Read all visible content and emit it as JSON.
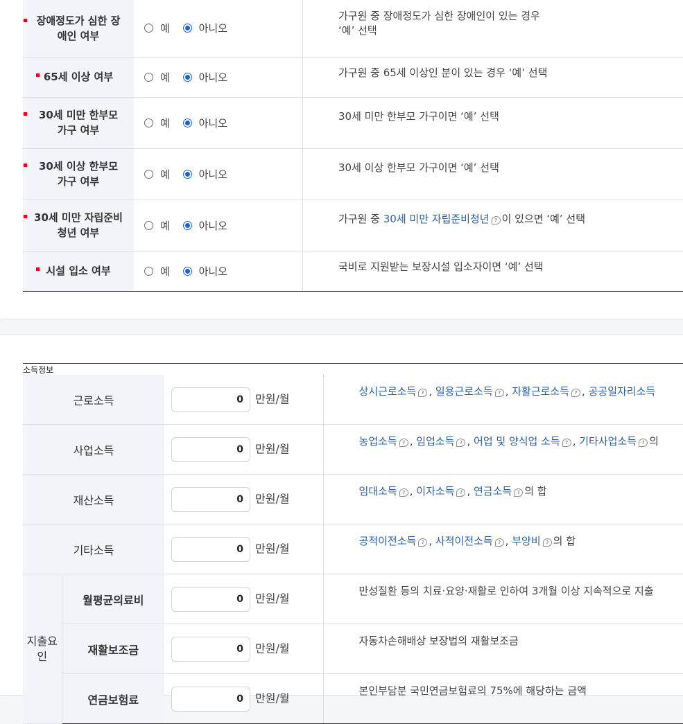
{
  "household": {
    "rows": [
      {
        "label_lines": [
          "장애정도가 심한 장",
          "애인 여부"
        ],
        "yes": "예",
        "no": "아니오",
        "selected": "no",
        "desc_lines": [
          "가구원 중 장애정도가 심한 장애인이 있는 경우",
          "‘예’ 선택"
        ]
      },
      {
        "label_lines": [
          "65세 이상 여부"
        ],
        "yes": "예",
        "no": "아니오",
        "selected": "no",
        "desc_lines": [
          "가구원 중 65세 이상인 분이 있는 경우 ‘예’ 선택"
        ]
      },
      {
        "label_lines": [
          "30세 미만 한부모",
          "가구 여부"
        ],
        "yes": "예",
        "no": "아니오",
        "selected": "no",
        "desc_lines": [
          "30세 미만 한부모 가구이면 ‘예’ 선택"
        ]
      },
      {
        "label_lines": [
          "30세 이상 한부모",
          "가구 여부"
        ],
        "yes": "예",
        "no": "아니오",
        "selected": "no",
        "desc_lines": [
          "30세 이상 한부모 가구이면 ‘예’ 선택"
        ]
      },
      {
        "label_lines": [
          "30세 미만 자립준비",
          "청년 여부"
        ],
        "yes": "예",
        "no": "아니오",
        "selected": "no",
        "desc_pre": "가구원 중 ",
        "desc_link": "30세 미만 자립준비청년",
        "desc_post": "이 있으면 ‘예’ 선택"
      },
      {
        "label_lines": [
          "시설 입소 여부"
        ],
        "yes": "예",
        "no": "아니오",
        "selected": "no",
        "desc_lines": [
          "국비로 지원받는 보장시설 입소자이면 ‘예’ 선택"
        ]
      }
    ]
  },
  "income": {
    "caption": "소득정보",
    "unit": "만원/월",
    "group_label_lines": [
      "지출요",
      "인"
    ],
    "rows": [
      {
        "label": "근로소득",
        "value": "0",
        "desc_links": [
          "상시근로소득",
          "일용근로소득",
          "자활근로소득",
          "공공일자리소득"
        ],
        "desc_tail": ""
      },
      {
        "label": "사업소득",
        "value": "0",
        "desc_links": [
          "농업소득",
          "임업소득",
          "어업 및 양식업 소득",
          "기타사업소득"
        ],
        "desc_tail": "의"
      },
      {
        "label": "재산소득",
        "value": "0",
        "desc_links": [
          "임대소득",
          "이자소득",
          "연금소득"
        ],
        "desc_tail": "의 합"
      },
      {
        "label": "기타소득",
        "value": "0",
        "desc_links": [
          "공적이전소득",
          "사적이전소득",
          "부양비"
        ],
        "desc_tail": "의 합"
      },
      {
        "label": "월평균의료비",
        "value": "0",
        "desc_text": "만성질환 등의 치료·요양·재활로 인하여 3개월 이상 지속적으로 지출"
      },
      {
        "label": "재활보조금",
        "value": "0",
        "desc_text": "자동차손해배상 보장법의 재활보조금"
      },
      {
        "label": "연금보험료",
        "value": "0",
        "desc_text": "본인부담분 국민연금보험료의 75%에 해당하는 금액"
      }
    ]
  },
  "colors": {
    "required_marker": "#e60012",
    "radio_selected": "#1a63d6",
    "link": "#2a5fa8",
    "label_bg": "#f2f4f9"
  }
}
